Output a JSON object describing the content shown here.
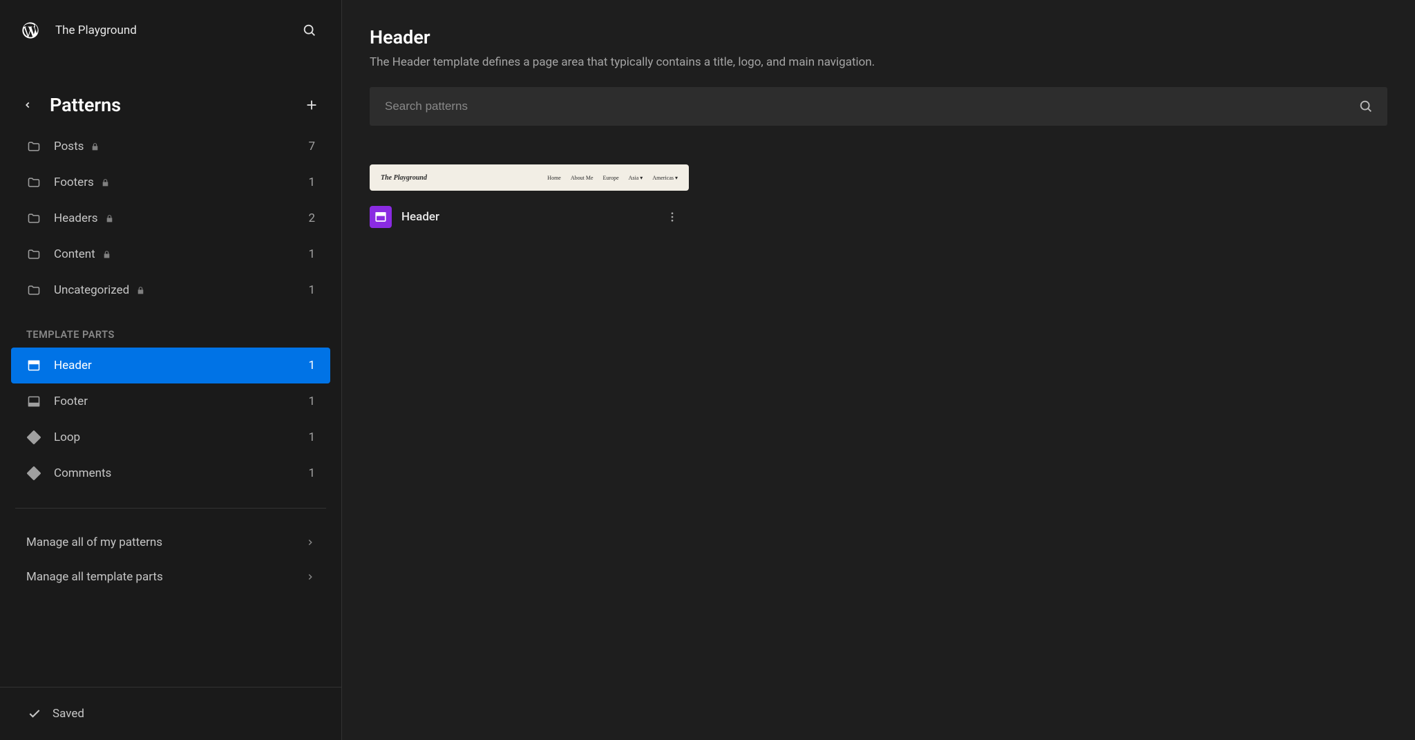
{
  "site": {
    "title": "The Playground"
  },
  "panel": {
    "title": "Patterns"
  },
  "sidebar": {
    "patterns": [
      {
        "label": "Posts",
        "locked": true,
        "count": "7",
        "icon": "folder"
      },
      {
        "label": "Footers",
        "locked": true,
        "count": "1",
        "icon": "folder"
      },
      {
        "label": "Headers",
        "locked": true,
        "count": "2",
        "icon": "folder"
      },
      {
        "label": "Content",
        "locked": true,
        "count": "1",
        "icon": "folder"
      },
      {
        "label": "Uncategorized",
        "locked": true,
        "count": "1",
        "icon": "folder"
      }
    ],
    "template_parts_label": "Template Parts",
    "template_parts": [
      {
        "label": "Header",
        "count": "1",
        "icon": "header",
        "active": true
      },
      {
        "label": "Footer",
        "count": "1",
        "icon": "footer",
        "active": false
      },
      {
        "label": "Loop",
        "count": "1",
        "icon": "loop",
        "active": false
      },
      {
        "label": "Comments",
        "count": "1",
        "icon": "loop",
        "active": false
      }
    ],
    "manage": [
      {
        "label": "Manage all of my patterns"
      },
      {
        "label": "Manage all template parts"
      }
    ],
    "saved": "Saved"
  },
  "main": {
    "title": "Header",
    "description": "The Header template defines a page area that typically contains a title, logo, and main navigation.",
    "search_placeholder": "Search patterns"
  },
  "card": {
    "title": "Header",
    "preview_title": "The Playground",
    "nav": [
      "Home",
      "About Me",
      "Europe",
      "Asia ▾",
      "Americas ▾"
    ]
  }
}
